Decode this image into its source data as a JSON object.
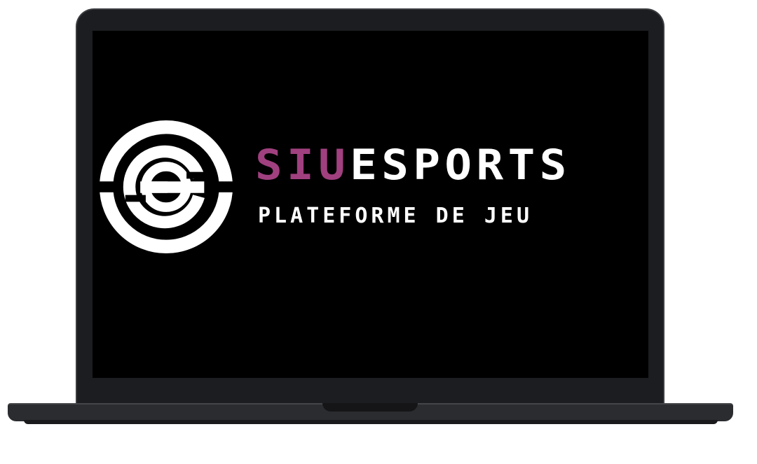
{
  "brand": {
    "accent_text": "SIU",
    "main_text": "ESPORTS",
    "accent_color": "#a0407f",
    "main_color": "#ffffff"
  },
  "tagline": "PLATEFORME DE JEU",
  "logo": {
    "icon": "siu-esports-logo-icon",
    "color": "#ffffff"
  },
  "device": {
    "type": "laptop-mockup",
    "screen_background": "#000000",
    "frame_color": "#1c1d20"
  }
}
